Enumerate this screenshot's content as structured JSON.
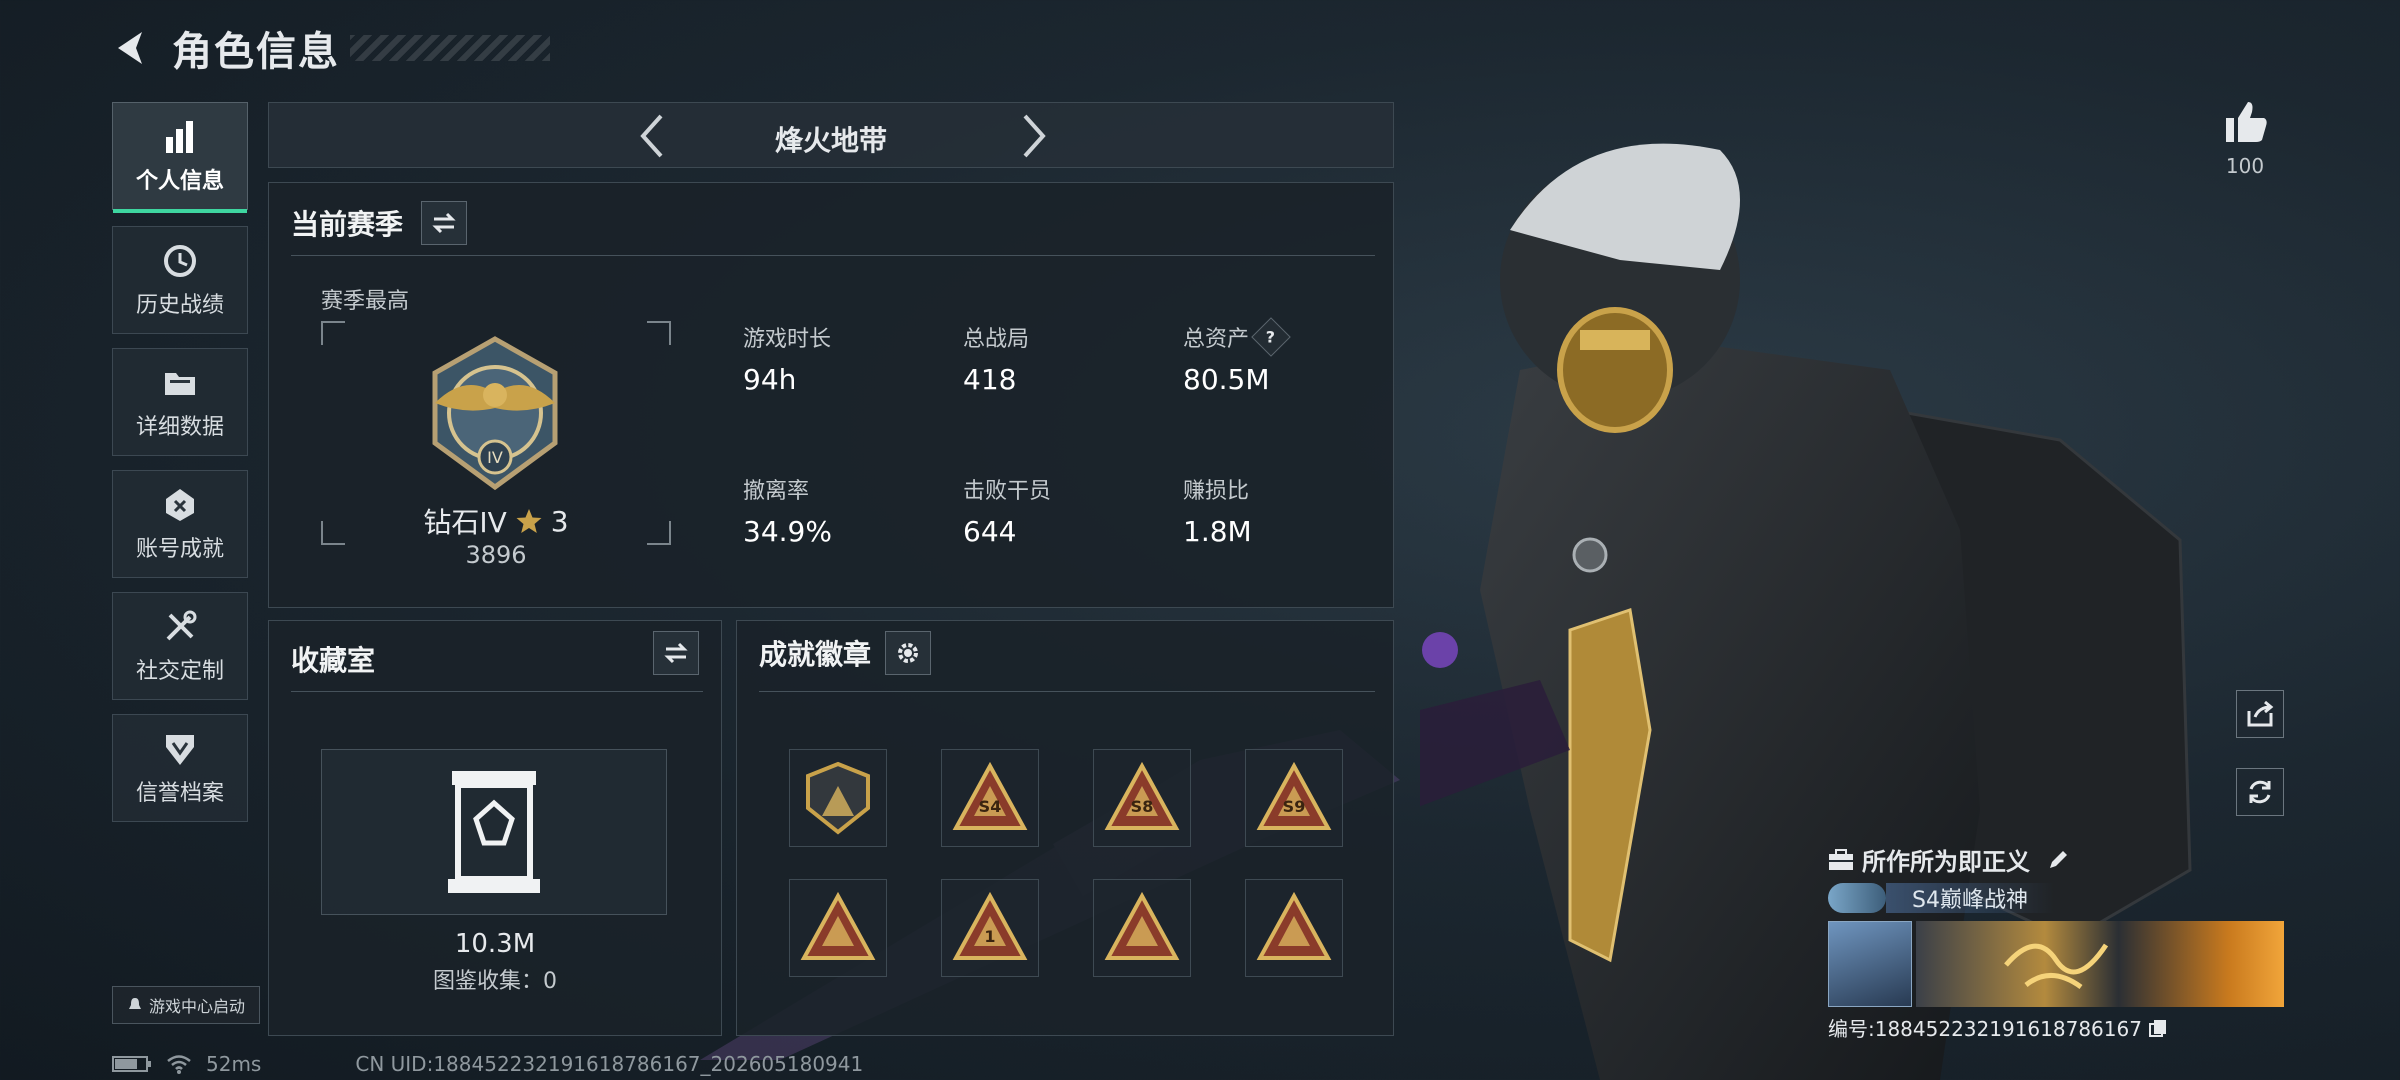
{
  "header": {
    "title": "角色信息"
  },
  "sidebar": {
    "items": [
      {
        "label": "个人信息",
        "icon": "bar-chart-icon",
        "active": true
      },
      {
        "label": "历史战绩",
        "icon": "history-clock-icon"
      },
      {
        "label": "详细数据",
        "icon": "folder-icon"
      },
      {
        "label": "账号成就",
        "icon": "achievement-icon"
      },
      {
        "label": "社交定制",
        "icon": "tools-icon"
      },
      {
        "label": "信誉档案",
        "icon": "credit-shield-icon"
      }
    ],
    "game_center_label": "游戏中心启动"
  },
  "mode_selector": {
    "label": "烽火地带"
  },
  "season": {
    "title": "当前赛季",
    "best_label": "赛季最高",
    "rank_name": "钻石IV",
    "rank_stars": "3",
    "rank_score": "3896",
    "stats": [
      {
        "label": "游戏时长",
        "value": "94h"
      },
      {
        "label": "总战局",
        "value": "418"
      },
      {
        "label": "总资产",
        "value": "80.5M",
        "help": "?"
      },
      {
        "label": "撤离率",
        "value": "34.9%"
      },
      {
        "label": "击败干员",
        "value": "644"
      },
      {
        "label": "赚损比",
        "value": "1.8M"
      }
    ]
  },
  "collection": {
    "title": "收藏室",
    "value": "10.3M",
    "catalog_label": "图鉴收集：0"
  },
  "achievements": {
    "title": "成就徽章",
    "badges": [
      {
        "icon": "triangle-rank-badge-icon",
        "text": ""
      },
      {
        "icon": "s4-season-badge-icon",
        "text": "S4"
      },
      {
        "icon": "s8-badge-icon",
        "text": "S8"
      },
      {
        "icon": "s9-badge-icon",
        "text": "S9"
      },
      {
        "icon": "crate-badge-icon",
        "text": ""
      },
      {
        "icon": "number-one-badge-icon",
        "text": "1"
      },
      {
        "icon": "helmet-badge-icon",
        "text": ""
      },
      {
        "icon": "rocket-badge-icon",
        "text": ""
      }
    ]
  },
  "right": {
    "likes": "100",
    "motto": "所作所为即正义",
    "title_tag": "S4巅峰战神",
    "id_label": "编号:18845223219161878616​7"
  },
  "status_bar": {
    "ping": "52ms",
    "uid": "CN UID:188452232191618786167_202605180941"
  },
  "colors": {
    "accent": "#3ed6a0",
    "gold": "#c9a24a",
    "panel_bg": "#1a2229"
  }
}
